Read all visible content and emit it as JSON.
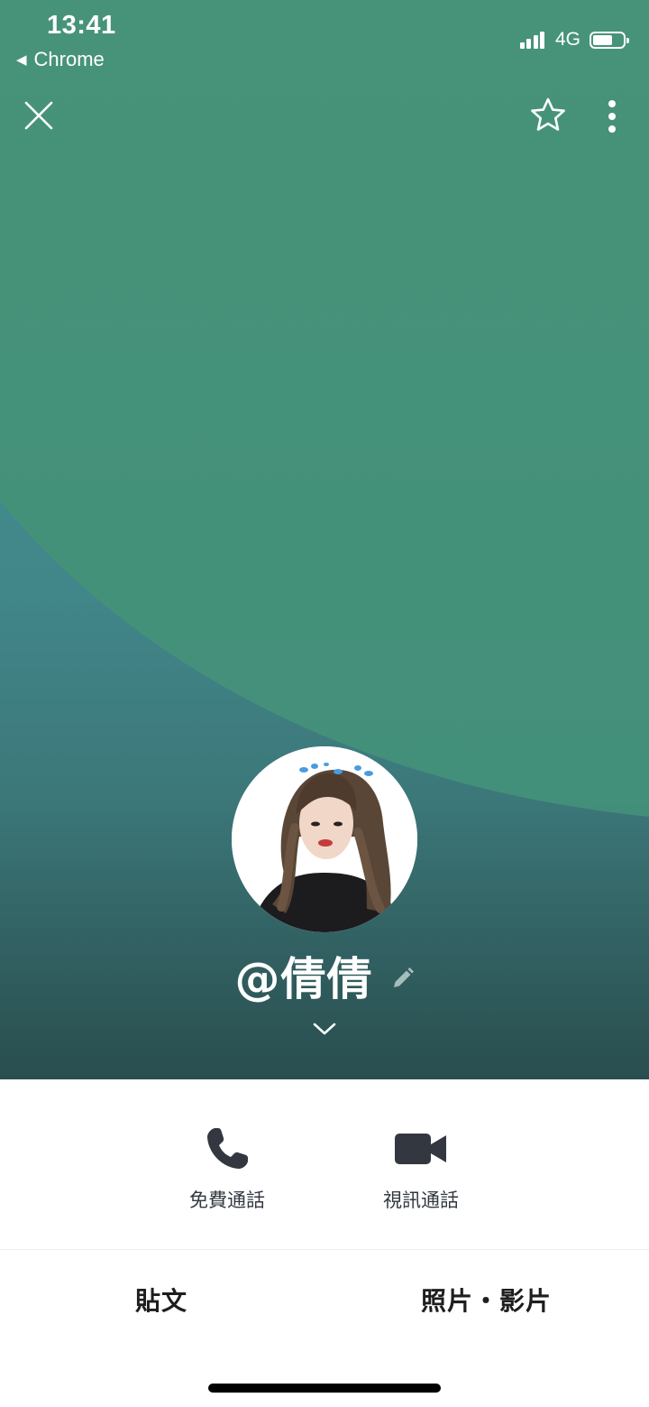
{
  "status_bar": {
    "time": "13:41",
    "back_app": "Chrome",
    "network": "4G",
    "battery_level": 0.65
  },
  "header": {
    "close_icon": "close-icon",
    "favorite_icon": "star-outline-icon",
    "more_icon": "more-vertical-icon"
  },
  "profile": {
    "display_name": "@倩倩",
    "edit_icon": "pencil-icon",
    "expand_icon": "chevron-down-icon"
  },
  "actions": {
    "voice_call_label": "免費通話",
    "video_call_label": "視訊通話"
  },
  "tabs": [
    {
      "label": "貼文"
    },
    {
      "label": "照片・影片"
    }
  ],
  "colors": {
    "cover_green": "#46927a",
    "cover_teal": "#3d8a8c",
    "icon_dark": "#333840",
    "text_dark": "#1e1e1e"
  }
}
